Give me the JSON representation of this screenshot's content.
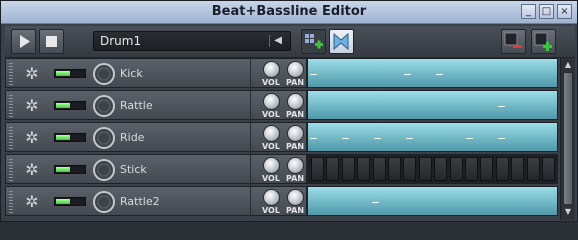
{
  "window": {
    "title": "Beat+Bassline Editor",
    "controls": [
      "minimize-icon",
      "maximize-icon",
      "close-icon"
    ]
  },
  "toolbar": {
    "play_icon": "play-icon",
    "stop_icon": "stop-icon",
    "pattern_select": "Drum1",
    "add_beat_icon": "add-beat-icon",
    "add_automation_icon": "add-automation-icon",
    "remove_steps_icon": "remove-steps-icon",
    "add_steps_icon": "add-steps-icon"
  },
  "tracks": [
    {
      "name": "Kick",
      "vol_label": "VOL",
      "pan_label": "PAN",
      "type": "sample"
    },
    {
      "name": "Rattle",
      "vol_label": "VOL",
      "pan_label": "PAN",
      "type": "sample"
    },
    {
      "name": "Ride",
      "vol_label": "VOL",
      "pan_label": "PAN",
      "type": "sample"
    },
    {
      "name": "Stick",
      "vol_label": "VOL",
      "pan_label": "PAN",
      "type": "steps"
    },
    {
      "name": "Rattle2",
      "vol_label": "VOL",
      "pan_label": "PAN",
      "type": "sample"
    }
  ],
  "colors": {
    "pattern": "#6fb8c6",
    "led": "#35d13a",
    "titlebar": "#b5c6df"
  }
}
